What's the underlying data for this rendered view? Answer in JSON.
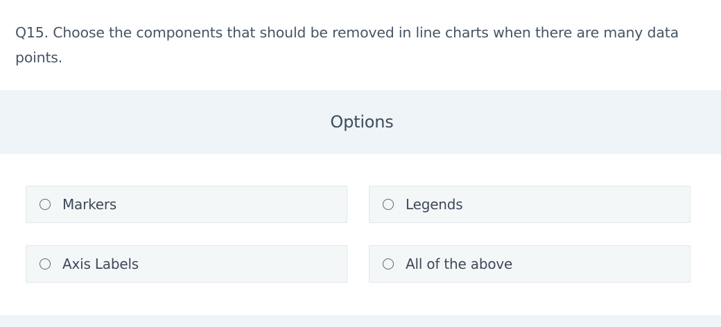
{
  "question": {
    "text": "Q15. Choose the components that should be removed in line charts when there are many data points."
  },
  "options_section": {
    "title": "Options"
  },
  "options": [
    {
      "label": "Markers"
    },
    {
      "label": "Legends"
    },
    {
      "label": "Axis Labels"
    },
    {
      "label": "All of the above"
    }
  ],
  "colors": {
    "header_background": "#eef4f7",
    "option_background": "#f3f7f8",
    "text": "#3e4858"
  }
}
